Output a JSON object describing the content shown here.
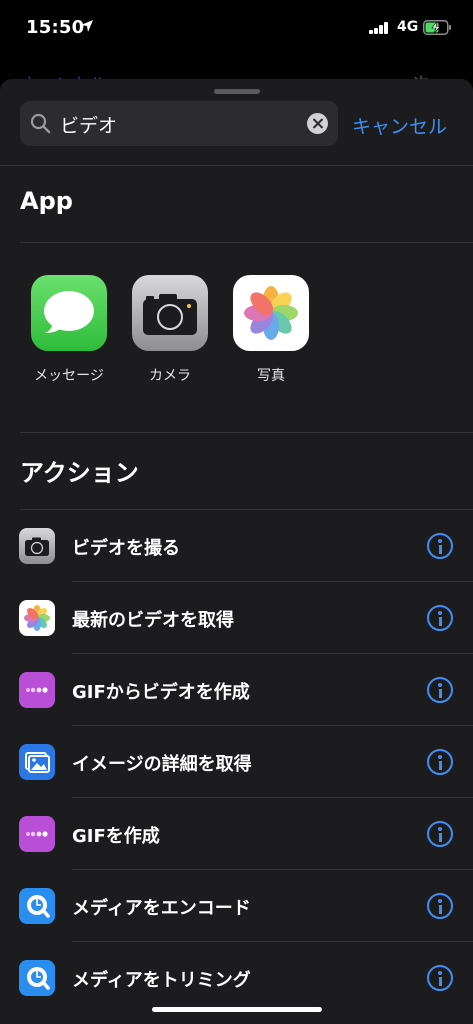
{
  "status_bar": {
    "time": "15:50",
    "network": "4G"
  },
  "background_nav": {
    "left": "キャンセル",
    "right": "次へ"
  },
  "search": {
    "query": "ビデオ",
    "cancel_label": "キャンセル"
  },
  "apps_section": {
    "title": "App",
    "items": [
      {
        "label": "メッセージ",
        "icon": "messages-icon"
      },
      {
        "label": "カメラ",
        "icon": "camera-icon"
      },
      {
        "label": "写真",
        "icon": "photos-icon"
      }
    ]
  },
  "actions_section": {
    "title": "アクション",
    "items": [
      {
        "label": "ビデオを撮る",
        "icon": "camera-icon"
      },
      {
        "label": "最新のビデオを取得",
        "icon": "photos-icon"
      },
      {
        "label": "GIFからビデオを作成",
        "icon": "gif-icon"
      },
      {
        "label": "イメージの詳細を取得",
        "icon": "image-icon"
      },
      {
        "label": "GIFを作成",
        "icon": "gif-icon"
      },
      {
        "label": "メディアをエンコード",
        "icon": "quicktime-icon"
      },
      {
        "label": "メディアをトリミング",
        "icon": "quicktime-icon"
      }
    ]
  },
  "colors": {
    "accent": "#3d8ff5",
    "sheet": "#1c1c1e",
    "gif": "#b94fd6",
    "image": "#2b77e6"
  }
}
